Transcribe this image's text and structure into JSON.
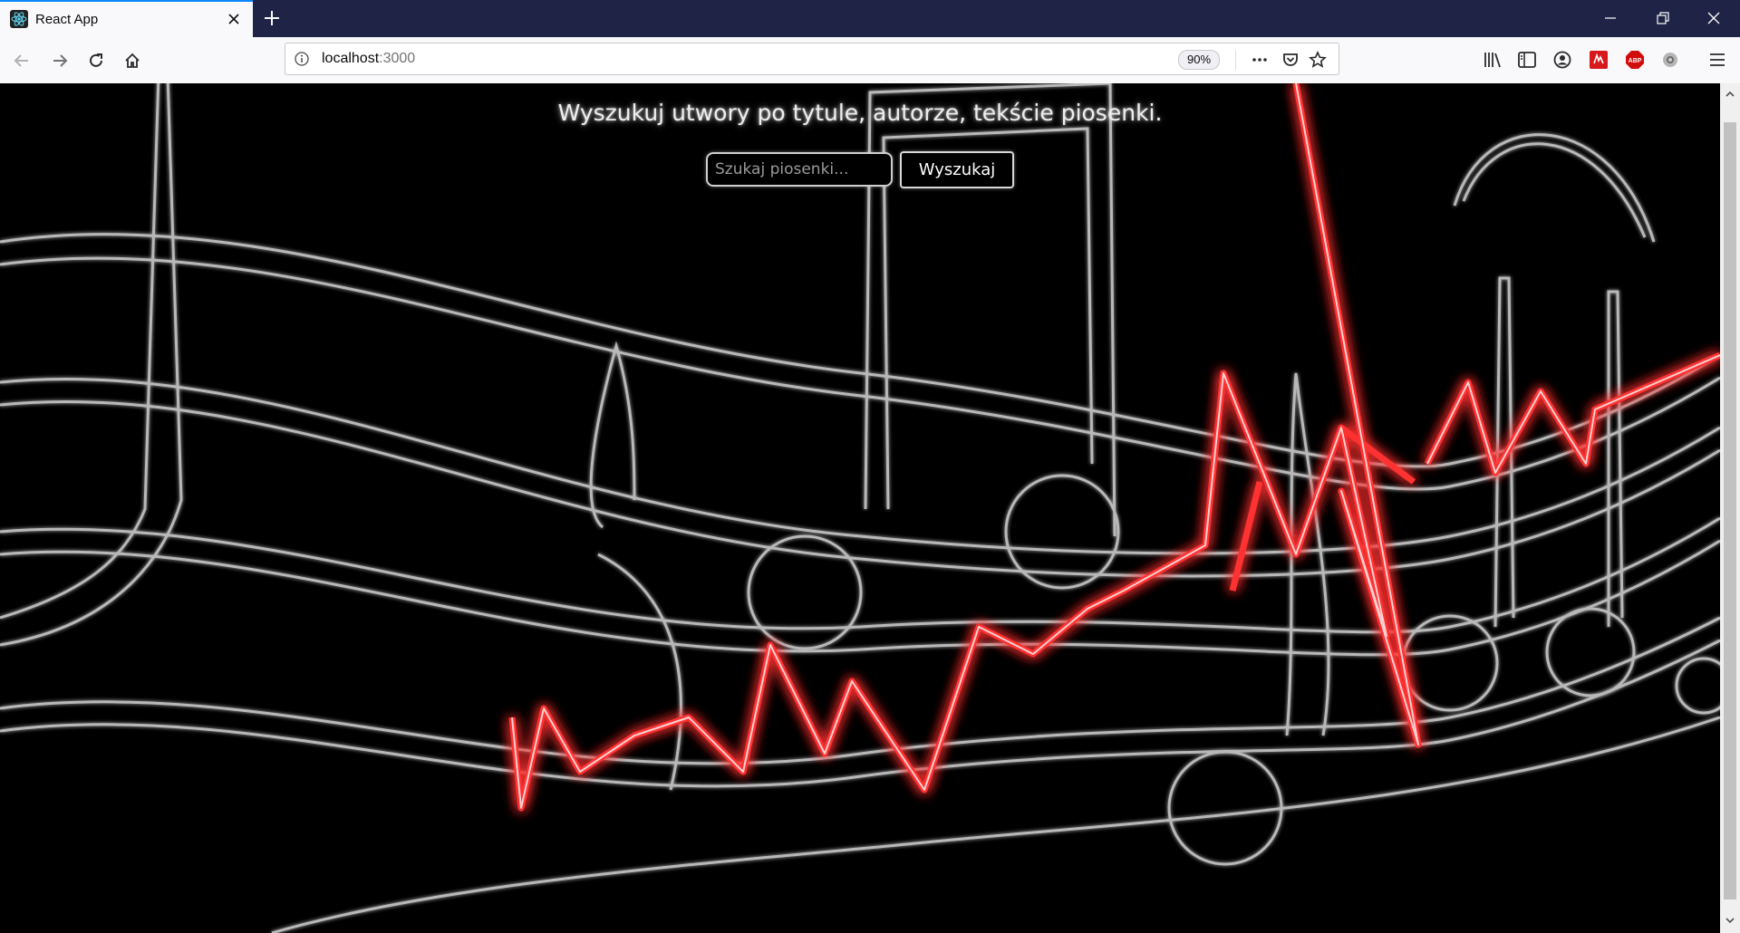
{
  "browser": {
    "tab_title": "React App",
    "url_host": "localhost",
    "url_port": ":3000",
    "zoom_level": "90%"
  },
  "page": {
    "heading": "Wyszukuj utwory po tytule, autorze, tekście piosenki.",
    "search_placeholder": "Szukaj piosenki...",
    "search_button_label": "Wyszukaj",
    "background": "music-staff-notes-neon-heartbeat"
  },
  "colors": {
    "page_bg": "#000000",
    "neon_red": "#ff2a2a",
    "staff_lines": "#bdbdbd",
    "tab_active_accent": "#0a84ff"
  }
}
